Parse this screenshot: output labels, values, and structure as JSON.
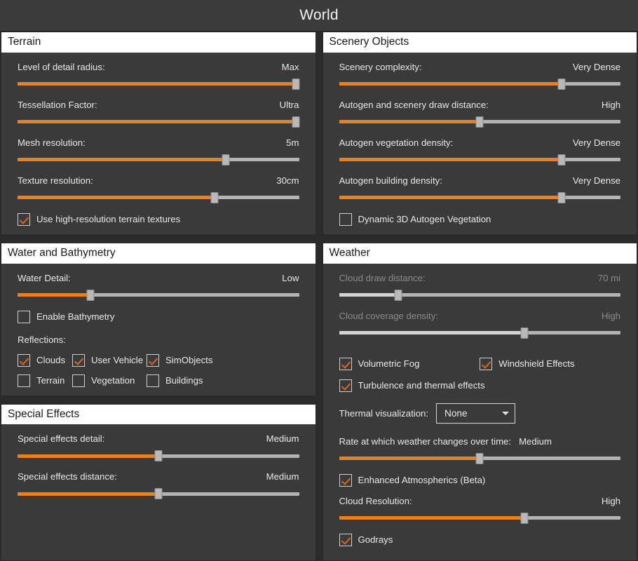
{
  "titlebar": {
    "title": "World"
  },
  "panels": {
    "terrain": {
      "header": "Terrain",
      "sliders": [
        {
          "label": "Level of detail radius:",
          "value": "Max",
          "percent": 99,
          "disabled": false
        },
        {
          "label": "Tessellation Factor:",
          "value": "Ultra",
          "percent": 99,
          "disabled": false
        },
        {
          "label": "Mesh resolution:",
          "value": "5m",
          "percent": 74,
          "disabled": false
        },
        {
          "label": "Texture resolution:",
          "value": "30cm",
          "percent": 70,
          "disabled": false
        }
      ],
      "checkboxes": [
        {
          "label": "Use high-resolution terrain textures",
          "checked": true
        }
      ]
    },
    "scenery_objects": {
      "header": "Scenery Objects",
      "sliders": [
        {
          "label": "Scenery complexity:",
          "value": "Very Dense",
          "percent": 79,
          "disabled": false
        },
        {
          "label": "Autogen and scenery draw distance:",
          "value": "High",
          "percent": 50,
          "disabled": false
        },
        {
          "label": "Autogen vegetation density:",
          "value": "Very Dense",
          "percent": 79,
          "disabled": false
        },
        {
          "label": "Autogen building density:",
          "value": "Very Dense",
          "percent": 79,
          "disabled": false
        }
      ],
      "checkboxes": [
        {
          "label": "Dynamic 3D Autogen Vegetation",
          "checked": false
        }
      ]
    },
    "water": {
      "header": "Water and Bathymetry",
      "sliders": [
        {
          "label": "Water Detail:",
          "value": "Low",
          "percent": 26,
          "disabled": false
        }
      ],
      "checkboxes": [
        {
          "label": "Enable Bathymetry",
          "checked": false
        }
      ],
      "reflections_label": "Reflections:",
      "reflections": [
        {
          "label": "Clouds",
          "checked": true
        },
        {
          "label": "User Vehicle",
          "checked": true
        },
        {
          "label": "SimObjects",
          "checked": true
        },
        {
          "label": "Terrain",
          "checked": false
        },
        {
          "label": "Vegetation",
          "checked": false
        },
        {
          "label": "Buildings",
          "checked": false
        }
      ]
    },
    "special_effects": {
      "header": "Special Effects",
      "sliders": [
        {
          "label": "Special effects detail:",
          "value": "Medium",
          "percent": 50,
          "disabled": false
        },
        {
          "label": "Special effects distance:",
          "value": "Medium",
          "percent": 50,
          "disabled": false
        }
      ]
    },
    "weather": {
      "header": "Weather",
      "sliders_disabled": [
        {
          "label": "Cloud draw distance:",
          "value": "70 mi",
          "percent": 21,
          "disabled": true
        },
        {
          "label": "Cloud coverage density:",
          "value": "High",
          "percent": 66,
          "disabled": true
        }
      ],
      "checkboxes_pair": [
        {
          "label": "Volumetric Fog",
          "checked": true
        },
        {
          "label": "Windshield Effects",
          "checked": true
        }
      ],
      "checkbox_single": {
        "label": "Turbulence and thermal effects",
        "checked": true
      },
      "dropdown": {
        "label": "Thermal visualization:",
        "value": "None",
        "options": [
          "None"
        ]
      },
      "rate_slider": {
        "label": "Rate at which weather changes over time:",
        "value": "Medium",
        "percent": 50,
        "disabled": false
      },
      "enhanced_atmospherics": {
        "label": "Enhanced Atmospherics (Beta)",
        "checked": true
      },
      "cloud_resolution": {
        "label": "Cloud Resolution:",
        "value": "High",
        "percent": 66,
        "disabled": false
      },
      "godrays": {
        "label": "Godrays",
        "checked": true
      }
    }
  },
  "colors": {
    "accent": "#e8821e",
    "check": "#e0651a",
    "page_bg": "#2b2b2b",
    "panel_bg": "#3a3a3a",
    "header_bg": "#ffffff",
    "track": "#b4b4b4"
  }
}
